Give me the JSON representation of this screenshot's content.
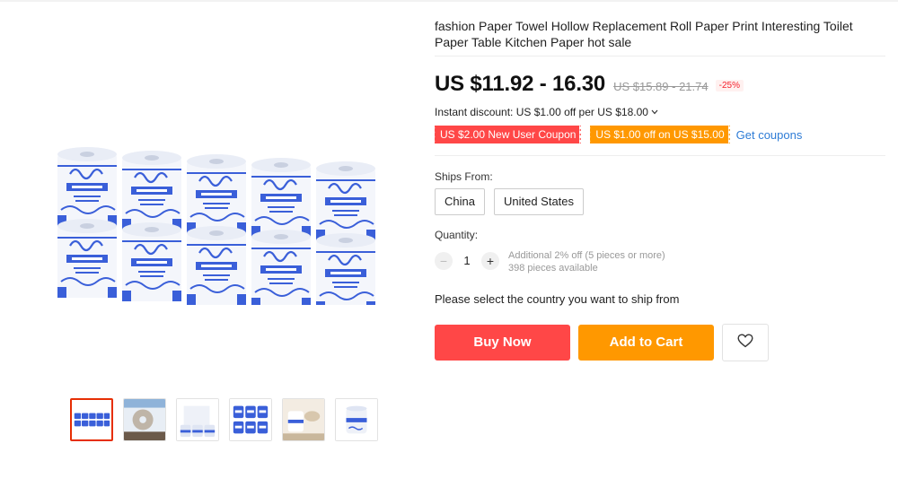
{
  "product": {
    "title": "fashion Paper Towel Hollow Replacement Roll Paper Print Interesting Toilet Paper Table Kitchen Paper hot sale",
    "price": "US $11.92 - 16.30",
    "original_price": "US $15.89 - 21.74",
    "discount": "-25%"
  },
  "promo": {
    "instant_discount": "Instant discount: US $1.00 off per US $18.00",
    "coupons": [
      "US $2.00 New User Coupon",
      "US $1.00 off on US $15.00"
    ],
    "get_coupons": "Get coupons"
  },
  "shipping": {
    "label": "Ships From:",
    "options": [
      "China",
      "United States"
    ]
  },
  "quantity": {
    "label": "Quantity:",
    "minus": "−",
    "plus": "+",
    "value": "1",
    "bulk_discount": "Additional 2% off (5 pieces or more)",
    "available": "398 pieces available"
  },
  "notice": "Please select the country you want to ship from",
  "buttons": {
    "buy_now": "Buy Now",
    "add_to_cart": "Add to Cart"
  },
  "icons": {
    "wishlist": "heart-icon",
    "instant_chevron": "chevron-down-icon"
  },
  "colors": {
    "accent_red": "#ff4747",
    "accent_orange": "#ff9800",
    "link_blue": "#2e7cd6",
    "roll_blue": "#3a5fd9"
  },
  "gallery": {
    "thumbnail_count": 6,
    "selected_index": 0
  }
}
